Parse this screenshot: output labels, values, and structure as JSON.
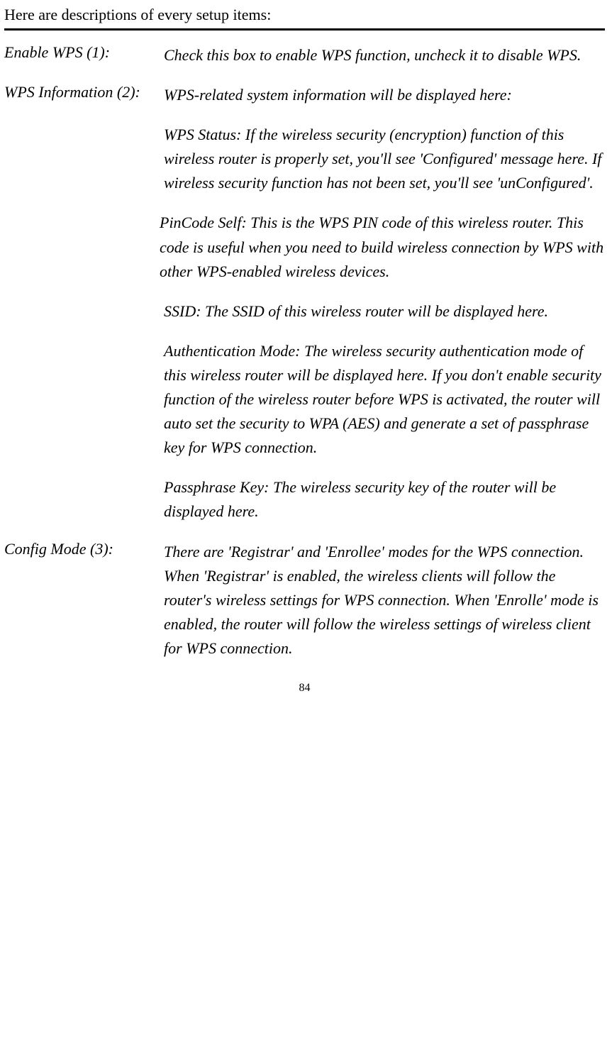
{
  "intro": "Here are descriptions of every setup items:",
  "items": [
    {
      "label": "Enable WPS (1):",
      "paras": [
        "Check this box to enable WPS function, uncheck it to disable WPS."
      ]
    },
    {
      "label": "WPS Information (2):",
      "paras": [
        "WPS-related system information will be displayed here:",
        "WPS Status: If the wireless security (encryption) function of this wireless router is properly set, you'll see 'Configured' message here. If wireless security function has not been set, you'll see 'unConfigured'.",
        "PinCode Self: This is the WPS PIN code of this wireless router. This code is useful when you need to build wireless connection by WPS with other WPS-enabled wireless devices.",
        "SSID: The SSID of this wireless router will be displayed here.",
        "Authentication Mode: The wireless security authentication mode of this wireless router will be displayed here. If you don't enable security function of the wireless router before WPS is activated, the router will auto set the security to WPA (AES) and generate a set of passphrase key for WPS connection.",
        "Passphrase Key: The wireless security key of the router will be displayed here."
      ]
    },
    {
      "label": "Config Mode (3):",
      "paras": [
        "There are 'Registrar' and 'Enrollee' modes for the WPS connection. When 'Registrar' is enabled, the wireless clients will follow the router's wireless settings for WPS connection. When 'Enrolle' mode is enabled, the router will follow the wireless settings of wireless client for WPS connection."
      ]
    }
  ],
  "pageNumber": "84"
}
